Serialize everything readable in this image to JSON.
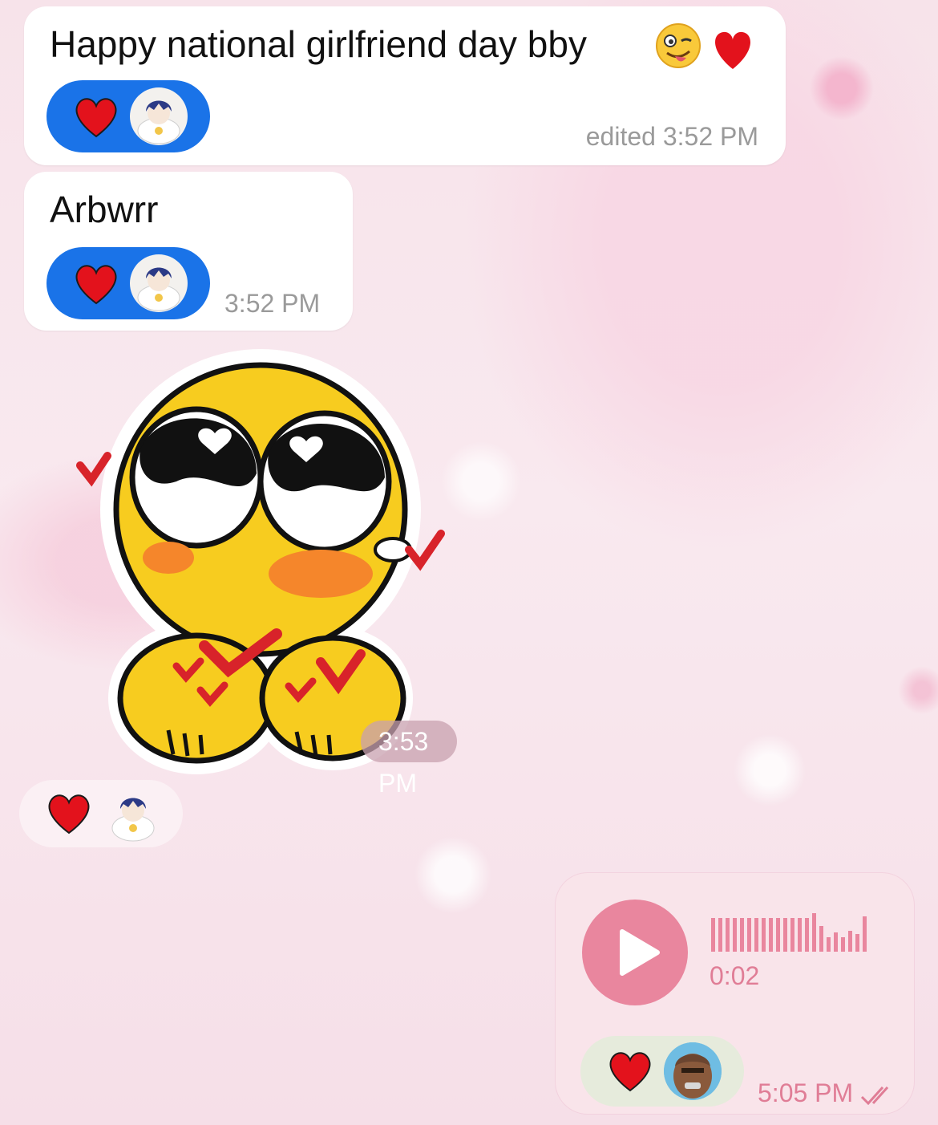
{
  "messages": {
    "m1": {
      "text": "Happy national girlfriend day bby",
      "emoji": "😜❤️",
      "time": "edited 3:52 PM",
      "reaction": "❤️"
    },
    "m2": {
      "text": "Arbwrr",
      "time": "3:52 PM",
      "reaction": "❤️"
    },
    "sticker": {
      "time": "3:53 PM"
    },
    "m4": {
      "reaction": "❤️"
    },
    "voice": {
      "duration": "0:02",
      "time": "5:05 PM",
      "reaction": "❤️"
    }
  },
  "colors": {
    "reaction_blue": "#1a73e8",
    "play_button": "#e9869e",
    "outgoing_bubble": "#f9e4ea",
    "heart_red": "#e3121c"
  }
}
